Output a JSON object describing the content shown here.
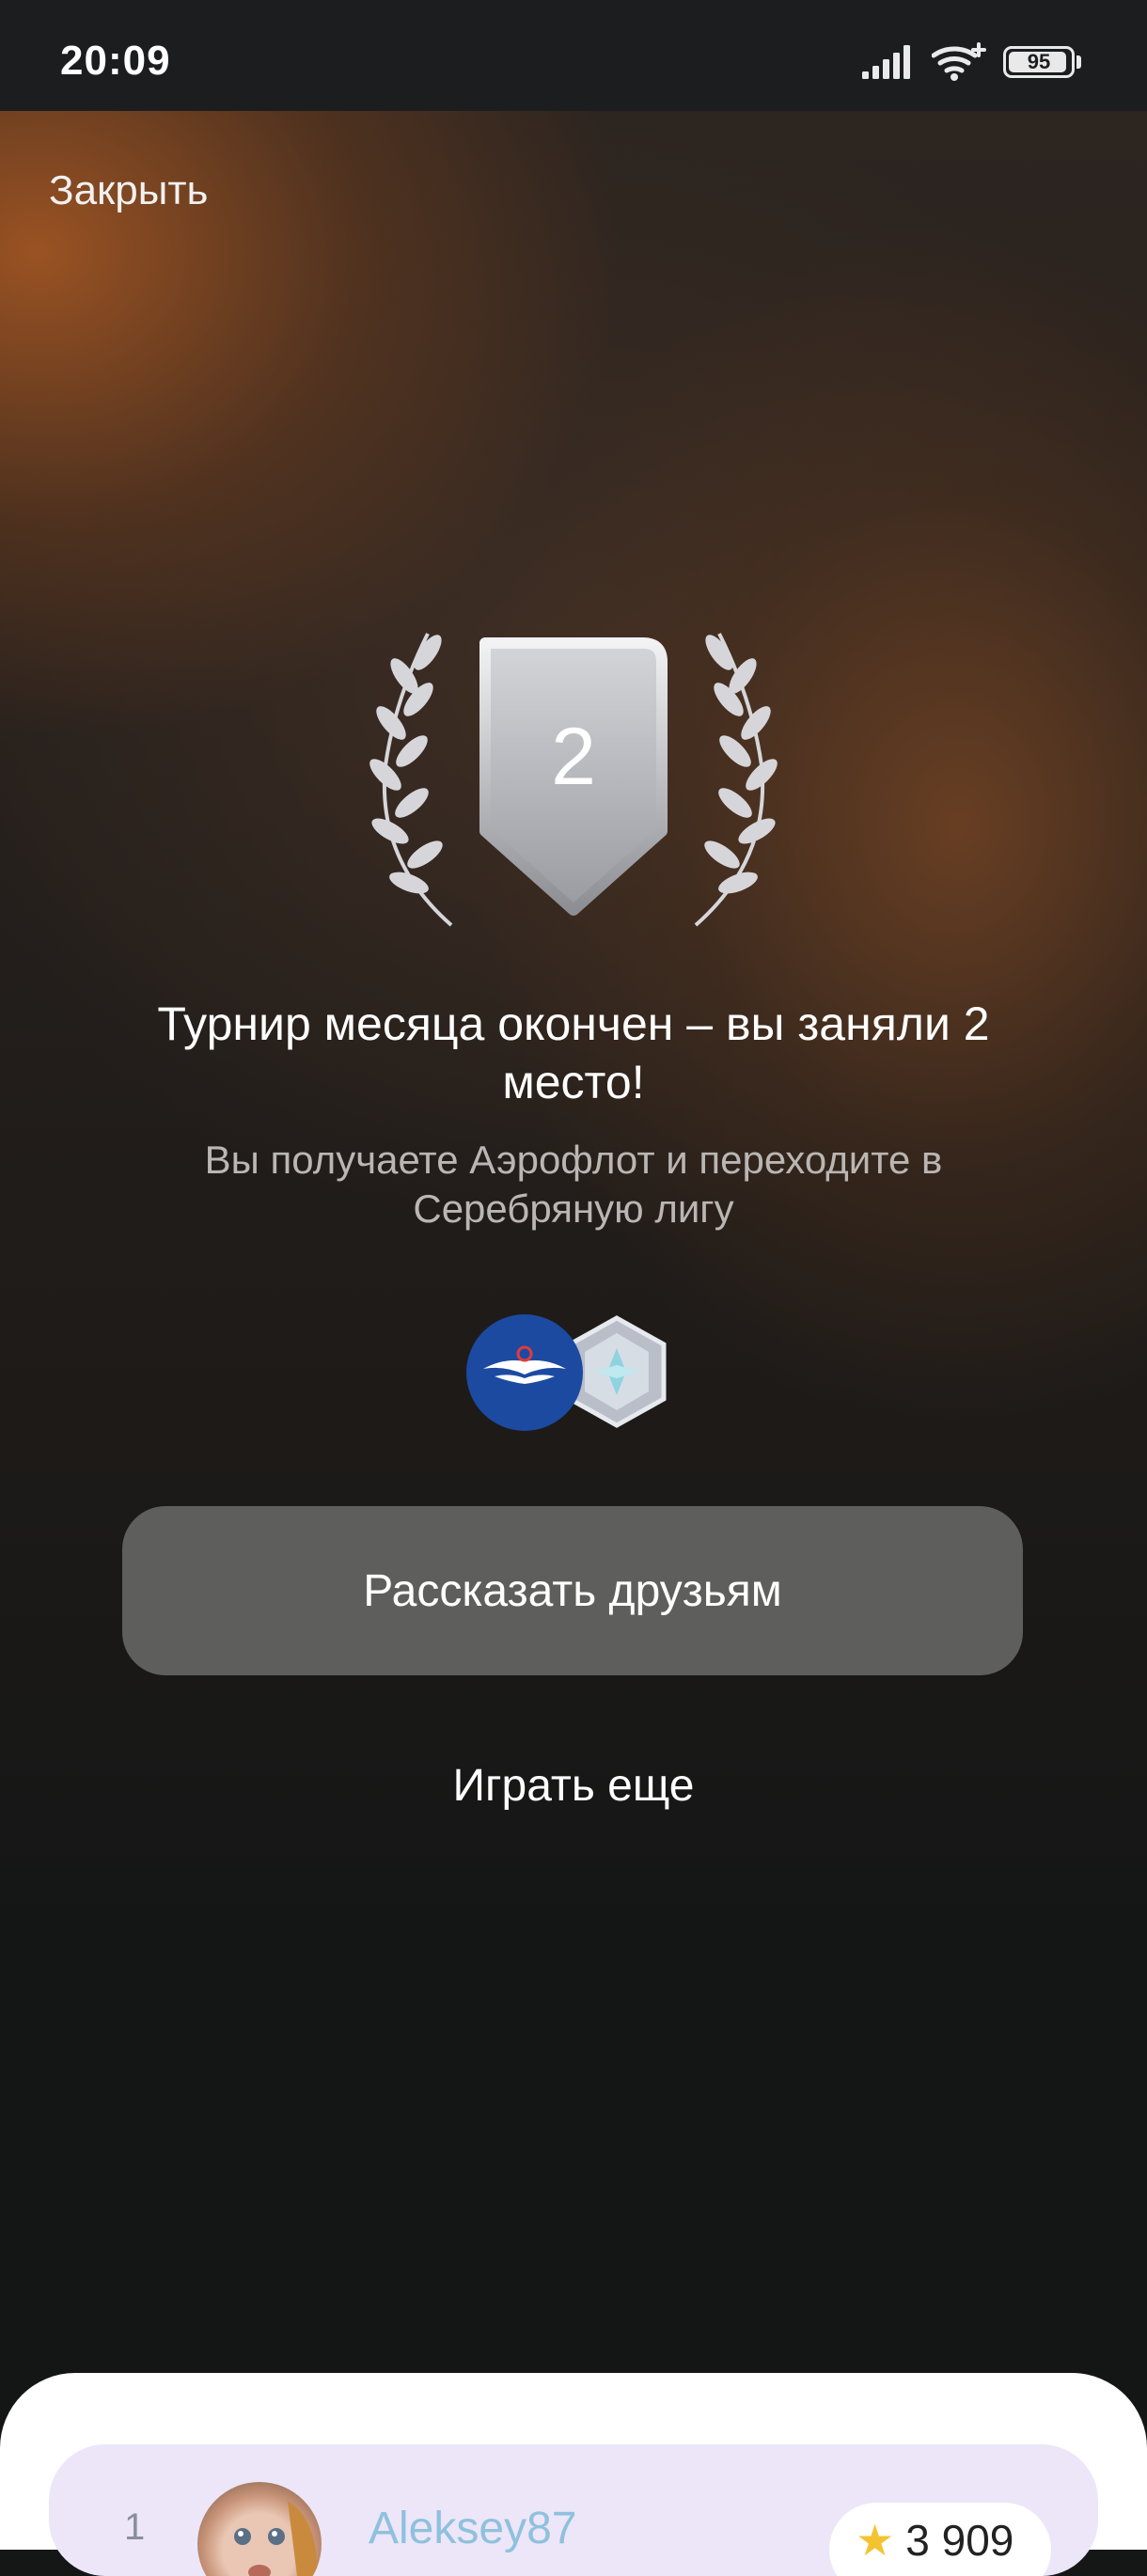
{
  "status_bar": {
    "time": "20:09",
    "battery": "95",
    "battery_level": 0.95,
    "icons": [
      "signal-icon",
      "wifi-icon",
      "battery-icon"
    ]
  },
  "header": {
    "close_label": "Закрыть"
  },
  "result": {
    "place": "2",
    "title": "Турнир месяца окончен – вы заняли 2 место!",
    "subtitle": "Вы получаете Аэрофлот и переходите в Серебряную лигу"
  },
  "rewards": {
    "icons": [
      "aeroflot-logo-icon",
      "silver-league-badge-icon"
    ]
  },
  "actions": {
    "share_label": "Рассказать друзьям",
    "play_again_label": "Играть еще"
  },
  "leaderboard": {
    "rows": [
      {
        "rank": "1",
        "username": "Aleksey87",
        "score": "3 909"
      }
    ]
  },
  "colors": {
    "share_button": "#5e5f5d",
    "row_bg": "#ece6f8",
    "username": "#8fc1dd",
    "star": "#f4c430"
  }
}
